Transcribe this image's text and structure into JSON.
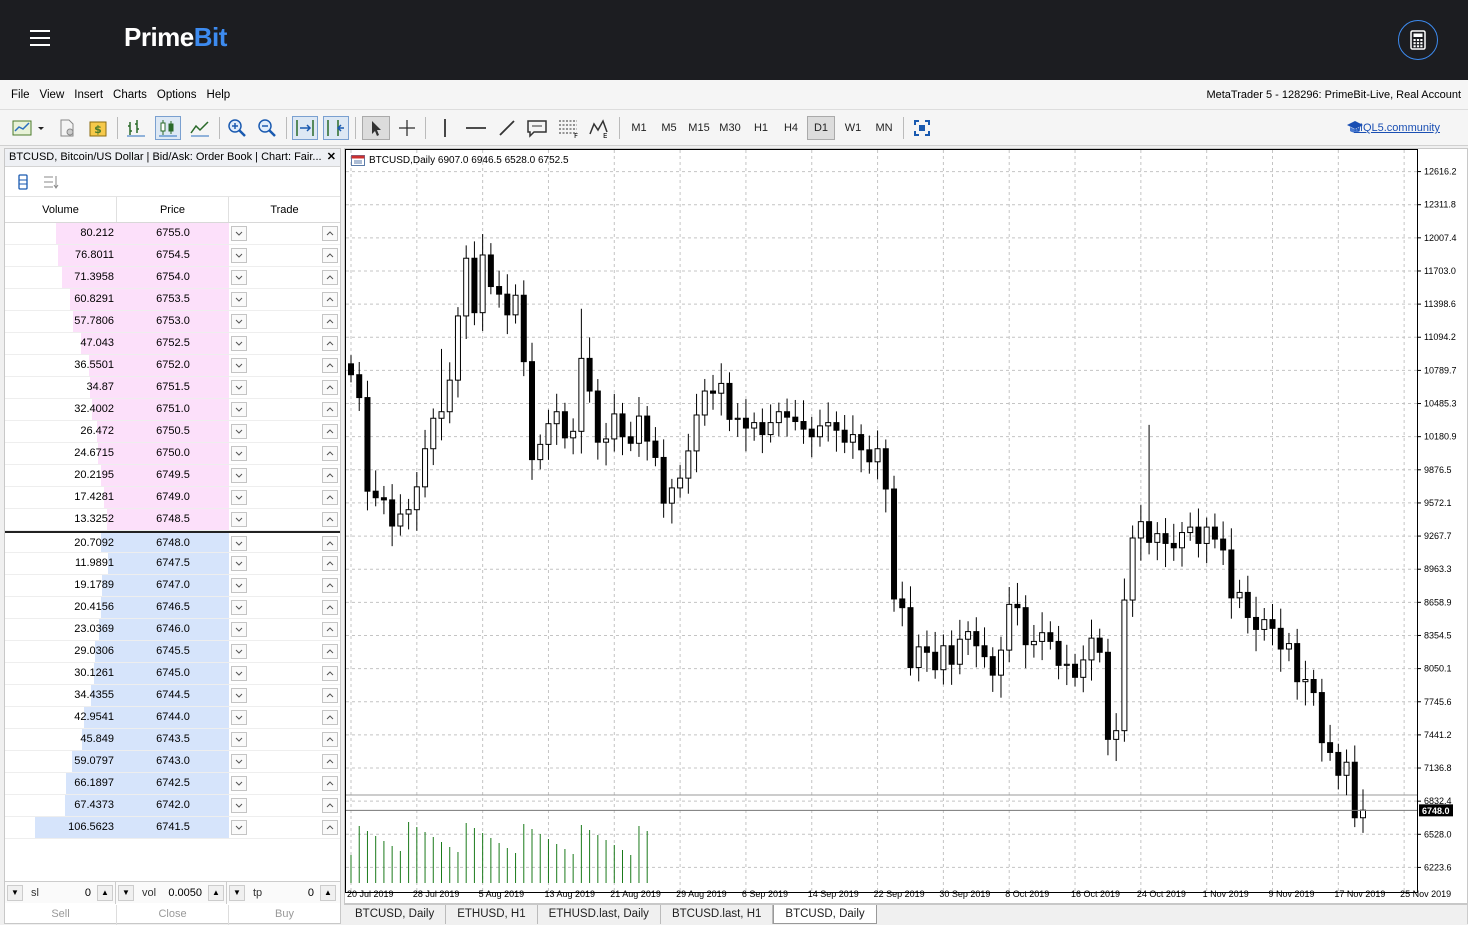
{
  "brand": {
    "name_part1": "Prime",
    "name_part2": "Bit"
  },
  "menu": [
    "File",
    "View",
    "Insert",
    "Charts",
    "Options",
    "Help"
  ],
  "account": "MetaTrader 5 - 128296: PrimeBit-Live, Real Account",
  "toolbar": {
    "timeframes": [
      "M1",
      "M5",
      "M15",
      "M30",
      "H1",
      "H4",
      "D1",
      "W1",
      "MN"
    ],
    "active_timeframe": "D1",
    "community_link": "MQL5.community"
  },
  "orderbook": {
    "title": "BTCUSD, Bitcoin/US Dollar | Bid/Ask: Order Book | Chart: Fair...",
    "headers": {
      "volume": "Volume",
      "price": "Price",
      "trade": "Trade"
    },
    "asks": [
      {
        "volume": "80.212",
        "price": "6755.0",
        "fill": 0.75
      },
      {
        "volume": "76.8011",
        "price": "6754.5",
        "fill": 0.72
      },
      {
        "volume": "71.3958",
        "price": "6754.0",
        "fill": 0.67
      },
      {
        "volume": "60.8291",
        "price": "6753.5",
        "fill": 0.57
      },
      {
        "volume": "57.7806",
        "price": "6753.0",
        "fill": 0.54
      },
      {
        "volume": "47.043",
        "price": "6752.5",
        "fill": 0.44
      },
      {
        "volume": "36.5501",
        "price": "6752.0",
        "fill": 0.34
      },
      {
        "volume": "34.87",
        "price": "6751.5",
        "fill": 0.33
      },
      {
        "volume": "32.4002",
        "price": "6751.0",
        "fill": 0.3
      },
      {
        "volume": "26.472",
        "price": "6750.5",
        "fill": 0.25
      },
      {
        "volume": "24.6715",
        "price": "6750.0",
        "fill": 0.23
      },
      {
        "volume": "20.2195",
        "price": "6749.5",
        "fill": 0.19
      },
      {
        "volume": "17.4281",
        "price": "6749.0",
        "fill": 0.16
      },
      {
        "volume": "13.3252",
        "price": "6748.5",
        "fill": 0.12
      }
    ],
    "bids": [
      {
        "volume": "20.7092",
        "price": "6748.0",
        "fill": 0.19
      },
      {
        "volume": "11.9891",
        "price": "6747.5",
        "fill": 0.11
      },
      {
        "volume": "19.1789",
        "price": "6747.0",
        "fill": 0.18
      },
      {
        "volume": "20.4156",
        "price": "6746.5",
        "fill": 0.19
      },
      {
        "volume": "23.0369",
        "price": "6746.0",
        "fill": 0.22
      },
      {
        "volume": "29.0306",
        "price": "6745.5",
        "fill": 0.27
      },
      {
        "volume": "30.1261",
        "price": "6745.0",
        "fill": 0.28
      },
      {
        "volume": "34.4355",
        "price": "6744.5",
        "fill": 0.32
      },
      {
        "volume": "42.9541",
        "price": "6744.0",
        "fill": 0.4
      },
      {
        "volume": "45.849",
        "price": "6743.5",
        "fill": 0.43
      },
      {
        "volume": "59.0797",
        "price": "6743.0",
        "fill": 0.55
      },
      {
        "volume": "66.1897",
        "price": "6742.5",
        "fill": 0.62
      },
      {
        "volume": "67.4373",
        "price": "6742.0",
        "fill": 0.63
      },
      {
        "volume": "106.5623",
        "price": "6741.5",
        "fill": 1.0
      }
    ],
    "sl": {
      "label": "sl",
      "value": "0"
    },
    "vol": {
      "label": "vol",
      "value": "0.0050"
    },
    "tp": {
      "label": "tp",
      "value": "0"
    },
    "actions": {
      "sell": "Sell",
      "close": "Close",
      "buy": "Buy"
    }
  },
  "chart_header": "BTCUSD,Daily  6907.0 6946.5 6528.0 6752.5",
  "tabs": [
    "BTCUSD, Daily",
    "ETHUSD, H1",
    "ETHUSD.last, Daily",
    "BTCUSD.last, H1",
    "BTCUSD, Daily"
  ],
  "active_tab": 4,
  "colors": {
    "ask_bg": "#fce0fa",
    "bid_bg": "#d6e4fb",
    "brand_blue": "#3d8bf0",
    "volume_green": "#1a7a1a"
  },
  "chart_data": {
    "type": "candlestick",
    "symbol": "BTCUSD",
    "timeframe": "Daily",
    "y_ticks": [
      "12616.2",
      "12311.8",
      "12007.4",
      "11703.0",
      "11398.6",
      "11094.2",
      "10789.7",
      "10485.3",
      "10180.9",
      "9876.5",
      "9572.1",
      "9267.7",
      "8963.3",
      "8658.9",
      "8354.5",
      "8050.1",
      "7745.6",
      "7441.2",
      "7136.8",
      "6832.4",
      "6528.0",
      "6223.6"
    ],
    "ylim": [
      6071.4,
      12768.4
    ],
    "x_ticks": [
      "20 Jul 2019",
      "28 Jul 2019",
      "5 Aug 2019",
      "13 Aug 2019",
      "21 Aug 2019",
      "29 Aug 2019",
      "6 Sep 2019",
      "14 Sep 2019",
      "22 Sep 2019",
      "30 Sep 2019",
      "8 Oct 2019",
      "16 Oct 2019",
      "24 Oct 2019",
      "1 Nov 2019",
      "9 Nov 2019",
      "17 Nov 2019",
      "25 Nov 2019"
    ],
    "current_price": "6748.0",
    "closes": [
      10750,
      10540,
      9680,
      9620,
      9600,
      9360,
      9470,
      9510,
      9720,
      10070,
      10350,
      10410,
      10700,
      11290,
      11820,
      11320,
      11850,
      11560,
      11490,
      11300,
      11480,
      10870,
      9970,
      10110,
      10300,
      10410,
      10170,
      10230,
      10900,
      10600,
      10130,
      10160,
      10390,
      10180,
      10120,
      10370,
      10140,
      9990,
      9570,
      9710,
      9800,
      10050,
      10380,
      10600,
      10580,
      10670,
      10340,
      10350,
      10260,
      10310,
      10200,
      10310,
      10410,
      10360,
      10320,
      10250,
      10180,
      10280,
      10310,
      10240,
      10130,
      10200,
      10060,
      9950,
      10070,
      9700,
      8690,
      8610,
      8060,
      8250,
      8200,
      8040,
      8260,
      8090,
      8320,
      8390,
      8260,
      8160,
      7990,
      8220,
      8640,
      8610,
      8270,
      8300,
      8380,
      8300,
      8080,
      8090,
      7970,
      8130,
      8330,
      8200,
      7400,
      7480,
      8680,
      9250,
      9400,
      9210,
      9290,
      9200,
      9160,
      9300,
      9350,
      9200,
      9350,
      9240,
      9140,
      8700,
      8750,
      8520,
      8410,
      8500,
      8420,
      8230,
      8280,
      7930,
      7950,
      7830,
      7370,
      7280,
      7070,
      7190,
      6680,
      6750
    ],
    "volume_bars_visible": 37
  }
}
